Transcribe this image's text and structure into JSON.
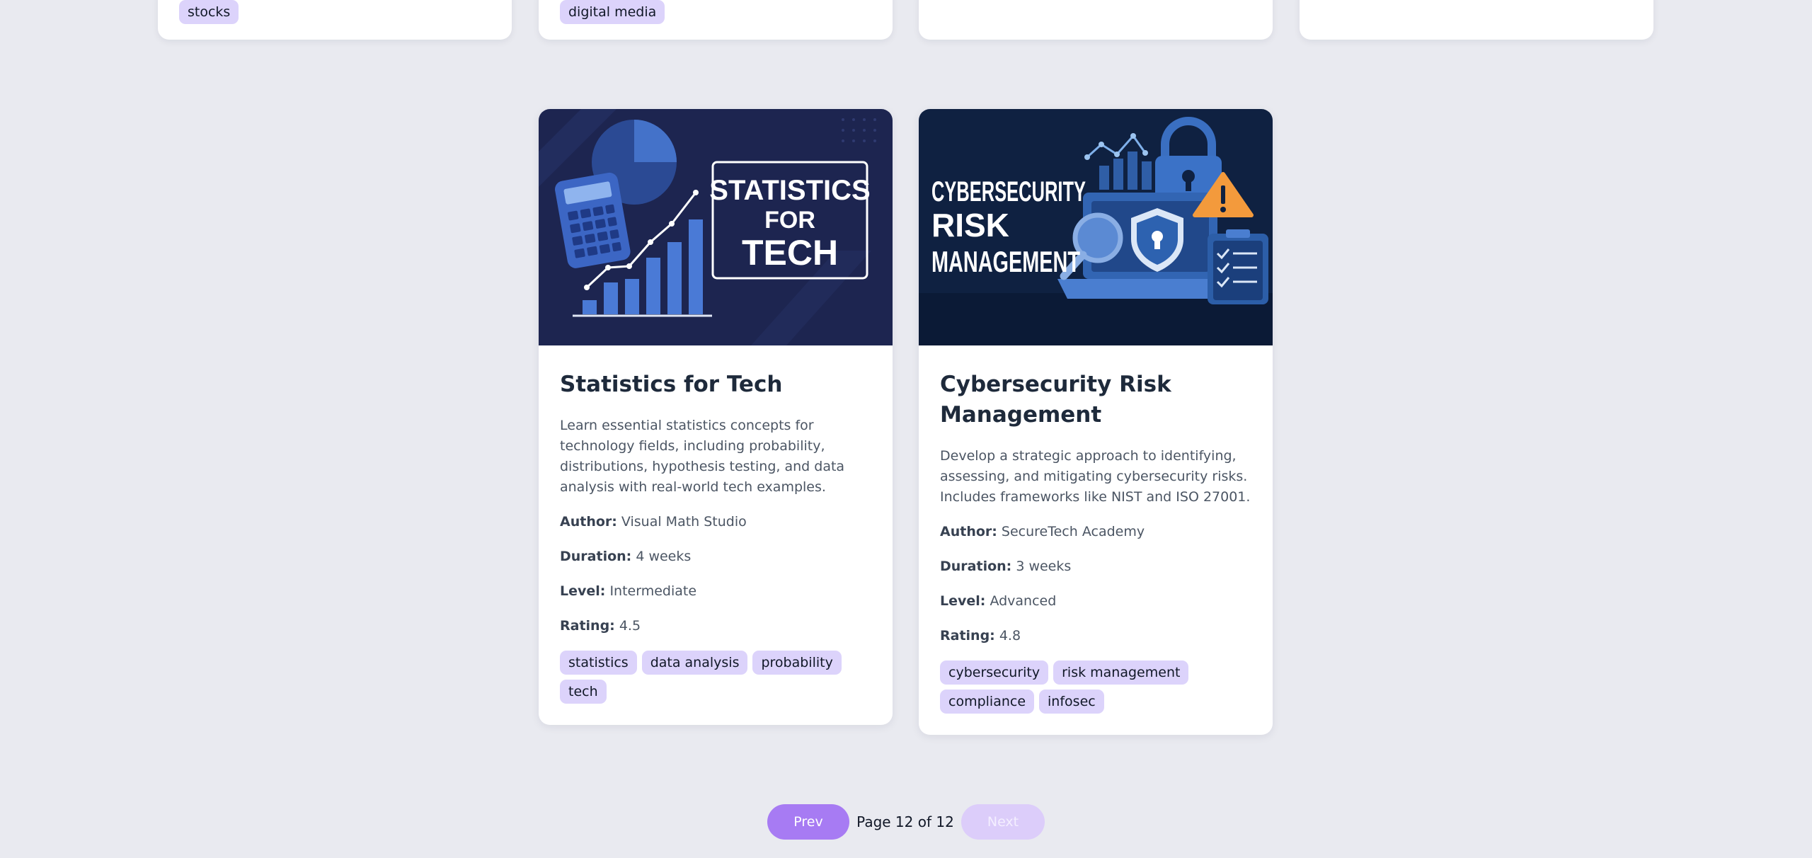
{
  "top_row": [
    {
      "tag": "stocks"
    },
    {
      "tag": "digital media"
    },
    {
      "tag": ""
    },
    {
      "tag": ""
    }
  ],
  "courses": [
    {
      "thumb_text": [
        "STATISTICS",
        "FOR",
        "TECH"
      ],
      "title": "Statistics for Tech",
      "description": "Learn essential statistics concepts for technology fields, including probability, distributions, hypothesis testing, and data analysis with real-world tech examples.",
      "author_label": "Author:",
      "author": "Visual Math Studio",
      "duration_label": "Duration:",
      "duration": "4 weeks",
      "level_label": "Level:",
      "level": "Intermediate",
      "rating_label": "Rating:",
      "rating": "4.5",
      "tags": [
        "statistics",
        "data analysis",
        "probability",
        "tech"
      ]
    },
    {
      "thumb_text": [
        "CYBERSECURITY",
        "RISK",
        "MANAGEMENT"
      ],
      "title": "Cybersecurity Risk Management",
      "description": "Develop a strategic approach to identifying, assessing, and mitigating cybersecurity risks. Includes frameworks like NIST and ISO 27001.",
      "author_label": "Author:",
      "author": "SecureTech Academy",
      "duration_label": "Duration:",
      "duration": "3 weeks",
      "level_label": "Level:",
      "level": "Advanced",
      "rating_label": "Rating:",
      "rating": "4.8",
      "tags": [
        "cybersecurity",
        "risk management",
        "compliance",
        "infosec"
      ]
    }
  ],
  "pagination": {
    "prev_label": "Prev",
    "page_label": "Page 12 of 12",
    "next_label": "Next"
  },
  "colors": {
    "background": "#e9eaf0",
    "tag_bg": "#dcd3fb",
    "accent": "#a77bf3",
    "accent_disabled": "#dccdfa",
    "thumb_dark": "#1b2347"
  }
}
